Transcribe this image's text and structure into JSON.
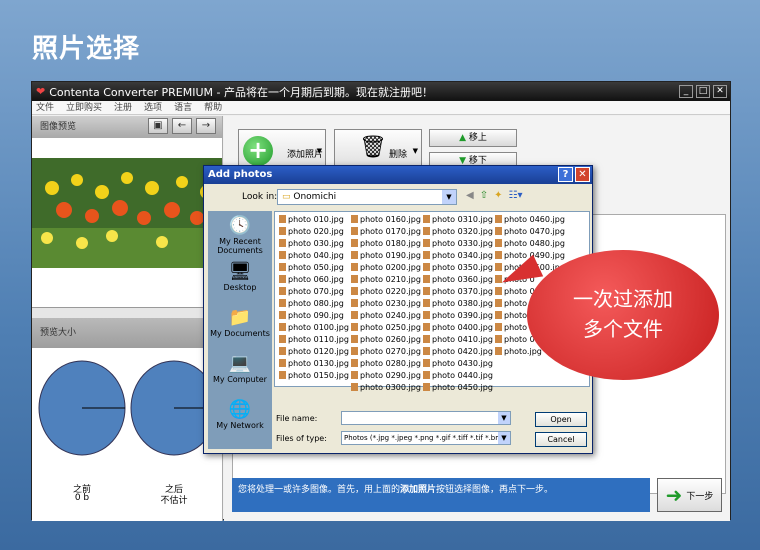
{
  "headline": "照片选择",
  "app": {
    "title": "Contenta Converter PREMIUM  - 产品将在一个月期后到期。现在就注册吧！",
    "window_controls": [
      "_",
      "□",
      "✕"
    ],
    "menu": [
      "文件",
      "立即购买",
      "注册",
      "选项",
      "语言",
      "帮助"
    ]
  },
  "left": {
    "preview_label": "图像预览",
    "size_label": "预览大小",
    "before_label": "之前",
    "before_value": "0 b",
    "after_label": "之后",
    "after_value": "不估计"
  },
  "toolbar": {
    "add_photos": "添加照片",
    "delete": "删除",
    "move_up": "移上",
    "move_down": "移下"
  },
  "info_text_prefix": "您将处理一或许多图像。首先，用上面的",
  "info_text_bold": "添加照片",
  "info_text_suffix": "按钮选择图像，再点下一步。",
  "next_button": "下一步",
  "dialog": {
    "title": "Add photos",
    "look_in_label": "Look in:",
    "look_in_value": "Onomichi",
    "places": [
      {
        "label": "My Recent Documents",
        "icon": "recent-documents-icon"
      },
      {
        "label": "Desktop",
        "icon": "desktop-icon"
      },
      {
        "label": "My Documents",
        "icon": "my-documents-icon"
      },
      {
        "label": "My Computer",
        "icon": "my-computer-icon"
      },
      {
        "label": "My Network",
        "icon": "my-network-icon"
      }
    ],
    "files_col1": [
      "photo 010.jpg",
      "photo 020.jpg",
      "photo 030.jpg",
      "photo 040.jpg",
      "photo 050.jpg",
      "photo 060.jpg",
      "photo 070.jpg",
      "photo 080.jpg",
      "photo 090.jpg",
      "photo 0100.jpg",
      "photo 0110.jpg",
      "photo 0120.jpg",
      "photo 0130.jpg",
      "photo 0150.jpg"
    ],
    "files_col2": [
      "photo 0160.jpg",
      "photo 0170.jpg",
      "photo 0180.jpg",
      "photo 0190.jpg",
      "photo 0200.jpg",
      "photo 0210.jpg",
      "photo 0220.jpg",
      "photo 0230.jpg",
      "photo 0240.jpg",
      "photo 0250.jpg",
      "photo 0260.jpg",
      "photo 0270.jpg",
      "photo 0280.jpg",
      "photo 0290.jpg",
      "photo 0300.jpg"
    ],
    "files_col3": [
      "photo 0310.jpg",
      "photo 0320.jpg",
      "photo 0330.jpg",
      "photo 0340.jpg",
      "photo 0350.jpg",
      "photo 0360.jpg",
      "photo 0370.jpg",
      "photo 0380.jpg",
      "photo 0390.jpg",
      "photo 0400.jpg",
      "photo 0410.jpg",
      "photo 0420.jpg",
      "photo 0430.jpg",
      "photo 0440.jpg",
      "photo 0450.jpg"
    ],
    "files_col4": [
      "photo 0460.jpg",
      "photo 0470.jpg",
      "photo 0480.jpg",
      "photo 0490.jpg",
      "photo 0500.jpg",
      "photo 0",
      "photo 05",
      "photo 05",
      "photo 0",
      "photo 0",
      "photo 0",
      "photo.jpg"
    ],
    "file_name_label": "File name:",
    "file_name_value": "",
    "files_of_type_label": "Files of type:",
    "files_of_type_value": "Photos (*.jpg *.jpeg *.png *.gif *.tiff *.tif *.bmp *.jp",
    "open_button": "Open",
    "cancel_button": "Cancel"
  },
  "callout_line1": "一次过添加",
  "callout_line2": "多个文件"
}
